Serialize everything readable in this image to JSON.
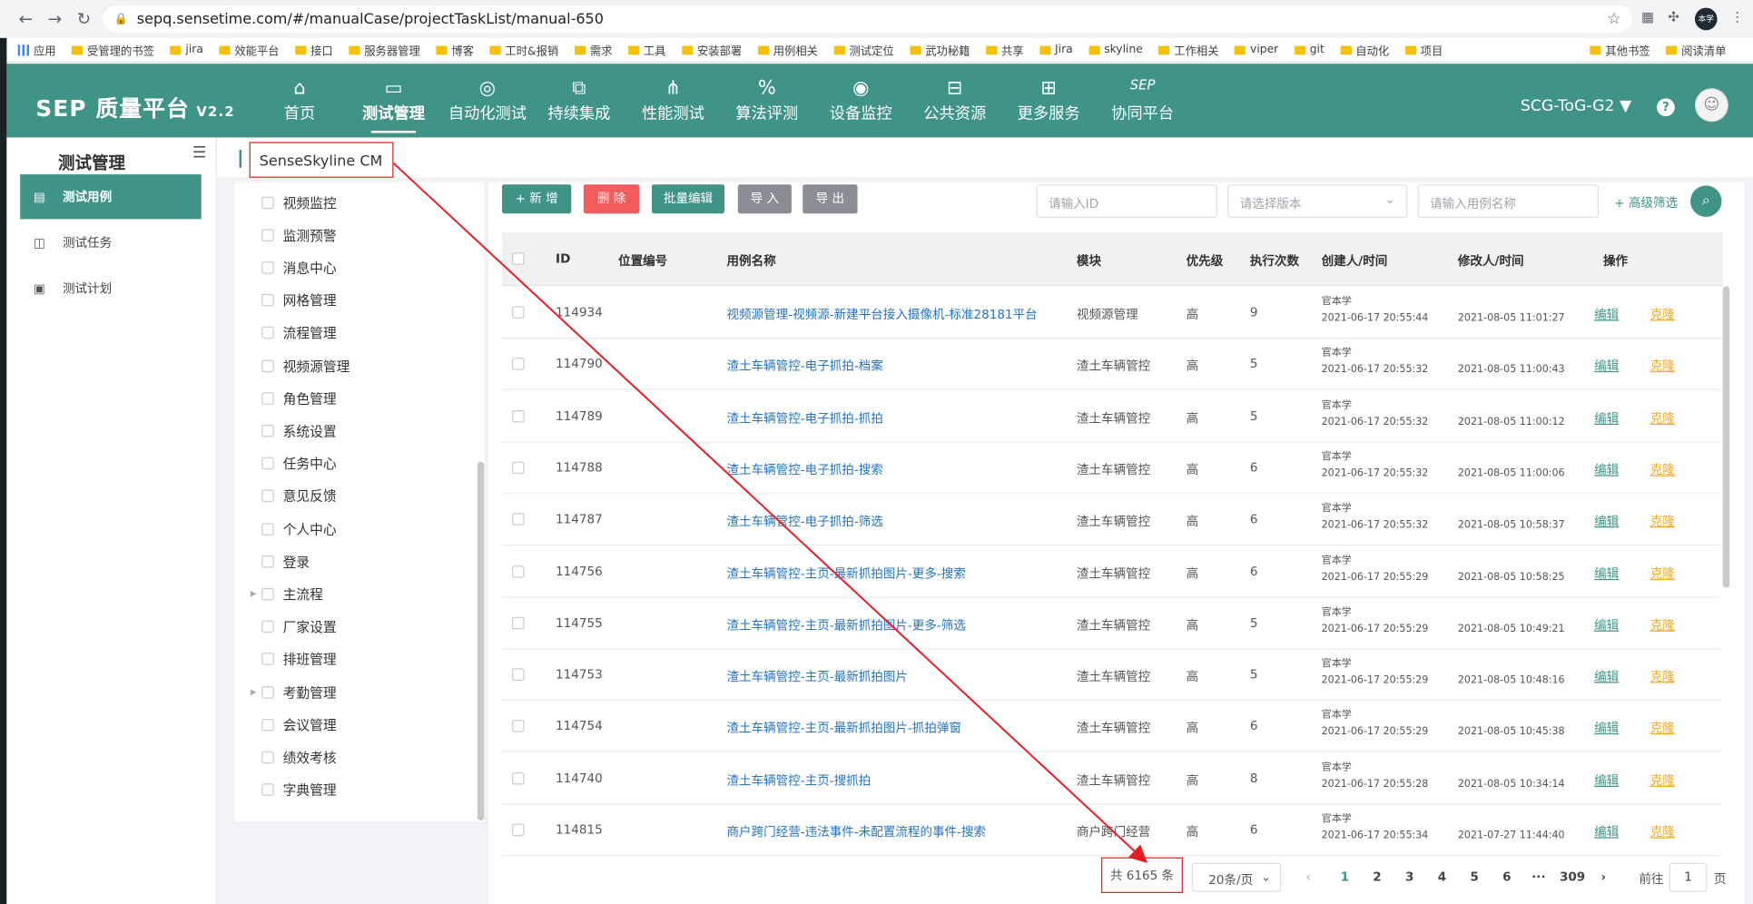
{
  "browser": {
    "url": "sepq.sensetime.com/#/manualCase/projectTaskList/manual-650",
    "profile": "本学",
    "bookmarks": [
      "应用",
      "受管理的书签",
      "jira",
      "效能平台",
      "接口",
      "服务器管理",
      "博客",
      "工时&报销",
      "需求",
      "工具",
      "安装部署",
      "用例相关",
      "测试定位",
      "武功秘籍",
      "共享",
      "Jira",
      "skyline",
      "工作相关",
      "viper",
      "git",
      "自动化",
      "项目"
    ],
    "bookmarks_right": [
      "其他书签",
      "阅读清单"
    ]
  },
  "header": {
    "logo": "SEP 质量平台",
    "version": "V2.2",
    "nav": [
      {
        "label": "首页",
        "icon": "home-icon",
        "glyph": "⌂"
      },
      {
        "label": "测试管理",
        "icon": "chart-icon",
        "glyph": "▭",
        "active": true
      },
      {
        "label": "自动化测试",
        "icon": "robot-icon",
        "glyph": "◎"
      },
      {
        "label": "持续集成",
        "icon": "pipeline-icon",
        "glyph": "⧉"
      },
      {
        "label": "性能测试",
        "icon": "network-icon",
        "glyph": "⋔"
      },
      {
        "label": "算法评测",
        "icon": "percent-icon",
        "glyph": "%"
      },
      {
        "label": "设备监控",
        "icon": "camera-icon",
        "glyph": "◉"
      },
      {
        "label": "公共资源",
        "icon": "printer-icon",
        "glyph": "⊟"
      },
      {
        "label": "更多服务",
        "icon": "grid-icon",
        "glyph": "⊞"
      },
      {
        "label": "协同平台",
        "icon": "sep-icon",
        "glyph": "SEP"
      }
    ],
    "team": "SCG-ToG-G2 ▼",
    "help": "?"
  },
  "sidebar": {
    "title": "测试管理",
    "items": [
      {
        "label": "测试用例",
        "active": true
      },
      {
        "label": "测试任务"
      },
      {
        "label": "测试计划"
      }
    ]
  },
  "breadcrumb": "SenseSkyline CM",
  "tree": [
    {
      "label": "视频监控"
    },
    {
      "label": "监测预警"
    },
    {
      "label": "消息中心"
    },
    {
      "label": "网格管理"
    },
    {
      "label": "流程管理"
    },
    {
      "label": "视频源管理"
    },
    {
      "label": "角色管理"
    },
    {
      "label": "系统设置"
    },
    {
      "label": "任务中心"
    },
    {
      "label": "意见反馈"
    },
    {
      "label": "个人中心"
    },
    {
      "label": "登录"
    },
    {
      "label": "主流程",
      "caret": true
    },
    {
      "label": "厂家设置"
    },
    {
      "label": "排班管理"
    },
    {
      "label": "考勤管理",
      "caret": true
    },
    {
      "label": "会议管理"
    },
    {
      "label": "绩效考核"
    },
    {
      "label": "字典管理"
    }
  ],
  "toolbar": {
    "add": "+ 新 增",
    "delete": "删 除",
    "batch_edit": "批量编辑",
    "import": "导 入",
    "export": "导 出",
    "id_placeholder": "请输入ID",
    "version_placeholder": "请选择版本",
    "name_placeholder": "请输入用例名称",
    "advanced": "+ 高级筛选"
  },
  "table": {
    "headers": [
      "ID",
      "位置编号",
      "用例名称",
      "模块",
      "优先级",
      "执行次数",
      "创建人/时间",
      "修改人/时间",
      "操作"
    ],
    "rows": [
      {
        "id": "114934",
        "name": "视频源管理-视频源-新建平台接入摄像机-标准28181平台",
        "module": "视频源管理",
        "priority": "高",
        "runs": "9",
        "creator": "官本学",
        "created": "2021-06-17 20:55:44",
        "modified": "2021-08-05 11:01:27"
      },
      {
        "id": "114790",
        "name": "渣土车辆管控-电子抓拍-档案",
        "module": "渣土车辆管控",
        "priority": "高",
        "runs": "5",
        "creator": "官本学",
        "created": "2021-06-17 20:55:32",
        "modified": "2021-08-05 11:00:43"
      },
      {
        "id": "114789",
        "name": "渣土车辆管控-电子抓拍-抓拍",
        "module": "渣土车辆管控",
        "priority": "高",
        "runs": "5",
        "creator": "官本学",
        "created": "2021-06-17 20:55:32",
        "modified": "2021-08-05 11:00:12"
      },
      {
        "id": "114788",
        "name": "渣土车辆管控-电子抓拍-搜索",
        "module": "渣土车辆管控",
        "priority": "高",
        "runs": "6",
        "creator": "官本学",
        "created": "2021-06-17 20:55:32",
        "modified": "2021-08-05 11:00:06"
      },
      {
        "id": "114787",
        "name": "渣土车辆管控-电子抓拍-筛选",
        "module": "渣土车辆管控",
        "priority": "高",
        "runs": "6",
        "creator": "官本学",
        "created": "2021-06-17 20:55:32",
        "modified": "2021-08-05 10:58:37"
      },
      {
        "id": "114756",
        "name": "渣土车辆管控-主页-最新抓拍图片-更多-搜索",
        "module": "渣土车辆管控",
        "priority": "高",
        "runs": "6",
        "creator": "官本学",
        "created": "2021-06-17 20:55:29",
        "modified": "2021-08-05 10:58:25"
      },
      {
        "id": "114755",
        "name": "渣土车辆管控-主页-最新抓拍图片-更多-筛选",
        "module": "渣土车辆管控",
        "priority": "高",
        "runs": "5",
        "creator": "官本学",
        "created": "2021-06-17 20:55:29",
        "modified": "2021-08-05 10:49:21"
      },
      {
        "id": "114753",
        "name": "渣土车辆管控-主页-最新抓拍图片",
        "module": "渣土车辆管控",
        "priority": "高",
        "runs": "5",
        "creator": "官本学",
        "created": "2021-06-17 20:55:29",
        "modified": "2021-08-05 10:48:16"
      },
      {
        "id": "114754",
        "name": "渣土车辆管控-主页-最新抓拍图片-抓拍弹窗",
        "module": "渣土车辆管控",
        "priority": "高",
        "runs": "6",
        "creator": "官本学",
        "created": "2021-06-17 20:55:29",
        "modified": "2021-08-05 10:45:38"
      },
      {
        "id": "114740",
        "name": "渣土车辆管控-主页-搜抓拍",
        "module": "渣土车辆管控",
        "priority": "高",
        "runs": "8",
        "creator": "官本学",
        "created": "2021-06-17 20:55:28",
        "modified": "2021-08-05 10:34:14"
      },
      {
        "id": "114815",
        "name": "商户跨门经营-违法事件-未配置流程的事件-搜索",
        "module": "商户跨门经营",
        "priority": "高",
        "runs": "6",
        "creator": "官本学",
        "created": "2021-06-17 20:55:34",
        "modified": "2021-07-27 11:44:40"
      }
    ],
    "edit_label": "编辑",
    "clone_label": "克隆"
  },
  "pagination": {
    "total": "共 6165 条",
    "page_size": "20条/页",
    "pages": [
      "1",
      "2",
      "3",
      "4",
      "5",
      "6",
      "···",
      "309"
    ],
    "current": "1",
    "goto_prefix": "前往",
    "goto_value": "1",
    "goto_suffix": "页"
  },
  "colors": {
    "brand": "#3f9487",
    "danger": "#f25c5c",
    "annotation": "#e31e24",
    "link": "#2473c5",
    "clone": "#f5a623"
  }
}
